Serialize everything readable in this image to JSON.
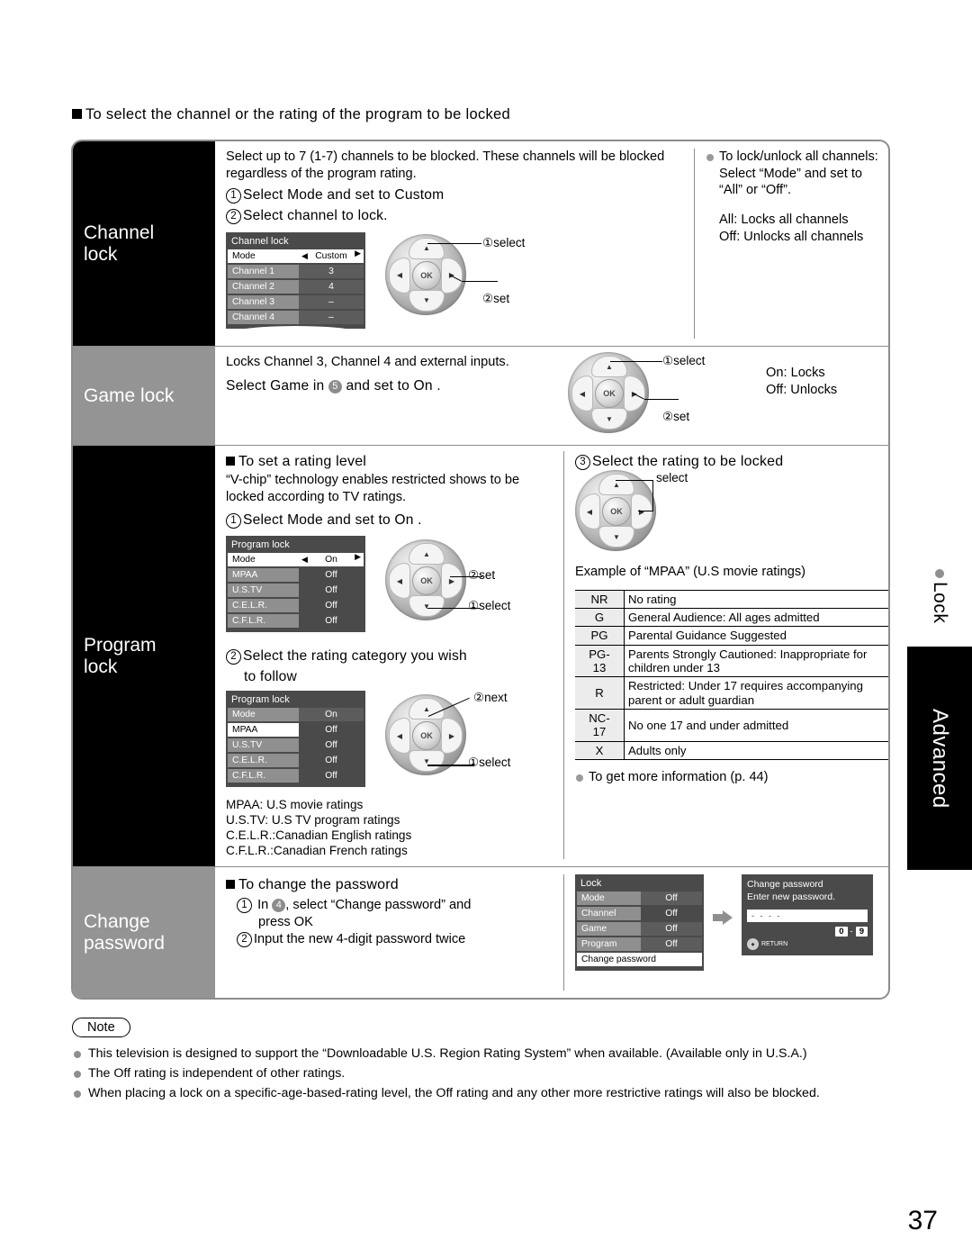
{
  "heading": "To select the channel or the rating of the program to be locked",
  "sections": {
    "channel_lock": {
      "label": "Channel\nlock",
      "intro": "Select up to 7 (1-7) channels to be blocked. These channels will be blocked regardless of the program rating.",
      "step1": "Select  Mode  and set to  Custom",
      "step2": "Select channel to lock.",
      "osd": {
        "title": "Channel lock",
        "rows": [
          {
            "key": "Mode",
            "value": "Custom",
            "selected": true
          },
          {
            "key": "Channel 1",
            "value": "3",
            "selected": false
          },
          {
            "key": "Channel 2",
            "value": "4",
            "selected": false
          },
          {
            "key": "Channel 3",
            "value": "–",
            "selected": false
          },
          {
            "key": "Channel 4",
            "value": "–",
            "selected": false
          }
        ]
      },
      "dpad_captions": {
        "up": "①select",
        "right": "②set"
      },
      "note_title": "To lock/unlock all channels:",
      "note_line2": "Select “Mode” and set to “All” or “Off”.",
      "note_all": "All:  Locks all channels",
      "note_off": "Off: Unlocks all channels"
    },
    "game_lock": {
      "label": "Game lock",
      "line1": "Locks Channel 3, Channel 4 and external inputs.",
      "line2_pre": "Select  Game  in",
      "line2_badge": "5",
      "line2_post": "and set to  On  .",
      "dpad_captions": {
        "up": "①select",
        "right": "②set"
      },
      "on_text": "On:  Locks",
      "off_text": "Off:  Unlocks"
    },
    "program_lock": {
      "label": "Program\nlock",
      "sub_heading": "To set a rating level",
      "vchip": "“V-chip” technology enables restricted shows to be locked according to TV ratings.",
      "step1": "Select  Mode  and set to  On  .",
      "osd1": {
        "title": "Program lock",
        "rows": [
          {
            "key": "Mode",
            "value": "On",
            "selected": true
          },
          {
            "key": "MPAA",
            "value": "Off",
            "selected": false
          },
          {
            "key": "U.S.TV",
            "value": "Off",
            "selected": false
          },
          {
            "key": "C.E.L.R.",
            "value": "Off",
            "selected": false
          },
          {
            "key": "C.F.L.R.",
            "value": "Off",
            "selected": false
          }
        ]
      },
      "dpad1_captions": {
        "right": "②set",
        "down": "①select"
      },
      "step2_line1": "Select the rating category you wish",
      "step2_line2": "to follow",
      "osd2": {
        "title": "Program lock",
        "rows": [
          {
            "key": "Mode",
            "value": "On",
            "selected": false
          },
          {
            "key": "MPAA",
            "value": "Off",
            "selected": true
          },
          {
            "key": "U.S.TV",
            "value": "Off",
            "selected": false
          },
          {
            "key": "C.E.L.R.",
            "value": "Off",
            "selected": false
          },
          {
            "key": "C.F.L.R.",
            "value": "Off",
            "selected": false
          }
        ]
      },
      "dpad2_captions": {
        "ok": "②next",
        "down": "①select"
      },
      "abbrev": [
        "MPAA:   U.S movie ratings",
        "U.S.TV:  U.S TV program ratings",
        "C.E.L.R.:Canadian English ratings",
        "C.F.L.R.:Canadian French ratings"
      ],
      "step3": "Select the rating to be locked",
      "dpad3_caption": "select",
      "example_caption": "Example of “MPAA” (U.S movie ratings)",
      "more_info": "To get more information (p. 44)",
      "rating_table": [
        {
          "code": "NR",
          "desc": "No rating"
        },
        {
          "code": "G",
          "desc": "General Audience:  All ages admitted"
        },
        {
          "code": "PG",
          "desc": "Parental Guidance Suggested"
        },
        {
          "code": "PG-\n13",
          "desc": "Parents Strongly Cautioned:  Inappropriate for children under 13"
        },
        {
          "code": "R",
          "desc": "Restricted:  Under 17 requires accompanying parent or adult guardian"
        },
        {
          "code": "NC-\n17",
          "desc": "No one 17 and under admitted"
        },
        {
          "code": "X",
          "desc": "Adults only"
        }
      ]
    },
    "change_password": {
      "label": "Change\npassword",
      "sub_heading": "To change the password",
      "step1_pre": "In",
      "step1_badge": "4",
      "step1_post": ", select “Change password” and",
      "step1_cont": "press OK",
      "step2": "Input the new 4-digit password twice",
      "osd": {
        "title": "Lock",
        "rows": [
          {
            "key": "Mode",
            "value": "Off",
            "selected": false
          },
          {
            "key": "Channel",
            "value": "Off",
            "selected": false
          },
          {
            "key": "Game",
            "value": "Off",
            "selected": false
          },
          {
            "key": "Program",
            "value": "Off",
            "selected": false
          },
          {
            "key": "Change password",
            "value": "",
            "selected": true,
            "full": true
          }
        ]
      },
      "pw_panel": {
        "title": "Change password",
        "prompt": "Enter new password.",
        "field_value": "- - - -",
        "digit_from": "0",
        "digit_sep": "-",
        "digit_to": "9",
        "return_label": "RETURN"
      }
    }
  },
  "sidebar": {
    "lock_label": "Lock",
    "advanced_label": "Advanced"
  },
  "note": {
    "title": "Note",
    "items": [
      "This television is designed to support the  “Downloadable U.S. Region Rating System” when available. (Available only in U.S.A.)",
      "The Off rating is independent of other ratings.",
      "When placing a lock on a specific-age-based-rating level, the Off rating and any other more restrictive ratings will also be blocked."
    ]
  },
  "page_number": "37"
}
